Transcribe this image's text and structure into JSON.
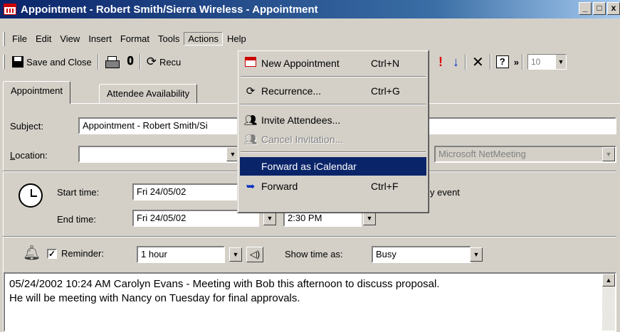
{
  "window": {
    "title": "Appointment - Robert Smith/Sierra Wireless - Appointment",
    "minimize": "_",
    "maximize": "□",
    "close": "x"
  },
  "menubar": {
    "items": [
      "File",
      "Edit",
      "View",
      "Insert",
      "Format",
      "Tools",
      "Actions",
      "Help"
    ],
    "active": "Actions"
  },
  "toolbar": {
    "save_close": "Save and Close",
    "recurrence_partial": "Recu",
    "more": "»",
    "font_size": "10"
  },
  "tabs": [
    "Appointment",
    "Attendee Availability"
  ],
  "form": {
    "subject_label": "Subject:",
    "subject_value": "Appointment - Robert Smith/Si",
    "location_label": "Location:",
    "location_value": "",
    "online_meeting_value": "Microsoft NetMeeting",
    "start_time_label": "Start time:",
    "start_date": "Fri 24/05/02",
    "all_day_partial": "y event",
    "end_time_label": "End time:",
    "end_date": "Fri 24/05/02",
    "end_time": "2:30 PM",
    "reminder_label": "Reminder:",
    "reminder_checked": true,
    "reminder_value": "1 hour",
    "show_time_as_label": "Show time as:",
    "show_time_as_value": "Busy"
  },
  "notes": {
    "lines": [
      "05/24/2002 10:24 AM Carolyn Evans - Meeting with Bob this afternoon to discuss proposal.",
      "He will be meeting with Nancy on Tuesday for final approvals."
    ]
  },
  "actions_menu": {
    "items": [
      {
        "icon": "new-appointment-icon",
        "label": "New Appointment",
        "shortcut": "Ctrl+N",
        "enabled": true,
        "highlighted": false
      },
      {
        "icon": "recurrence-icon",
        "label": "Recurrence...",
        "shortcut": "Ctrl+G",
        "enabled": true,
        "highlighted": false
      },
      {
        "icon": "invite-attendees-icon",
        "label": "Invite Attendees...",
        "shortcut": "",
        "enabled": true,
        "highlighted": false
      },
      {
        "icon": "cancel-invitation-icon",
        "label": "Cancel Invitation...",
        "shortcut": "",
        "enabled": false,
        "highlighted": false
      },
      {
        "icon": "",
        "label": "Forward as iCalendar",
        "shortcut": "",
        "enabled": true,
        "highlighted": true
      },
      {
        "icon": "forward-icon",
        "label": "Forward",
        "shortcut": "Ctrl+F",
        "enabled": true,
        "highlighted": false
      }
    ]
  },
  "colors": {
    "titlebar": "#0a246a",
    "highlight": "#0a246a",
    "face": "#d4d0c8",
    "importance_high": "#e00000",
    "importance_low": "#0030c0"
  }
}
